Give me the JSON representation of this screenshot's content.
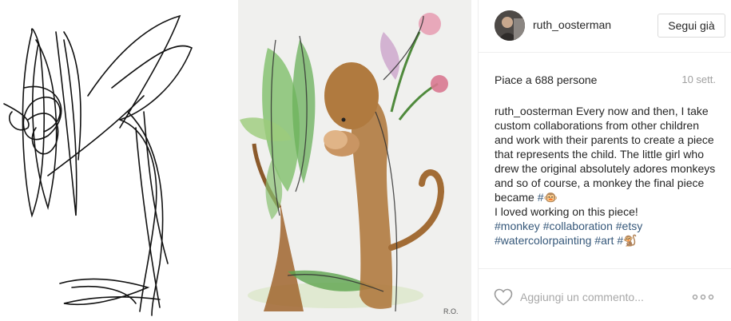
{
  "header": {
    "username": "ruth_oosterman",
    "follow_label": "Segui già"
  },
  "stats": {
    "likes_text": "Piace a 688 persone",
    "time_text": "10 sett."
  },
  "caption": {
    "username": "ruth_oosterman",
    "text": "Every now and then, I take custom collaborations from other children and work with their parents to create a piece that represents the child. The little girl who drew the original absolutely adores monkeys and so of course, a monkey the final piece became",
    "inline_tag": "#🐵",
    "line2": "I loved working on this piece!",
    "tags": [
      "#monkey",
      "#collaboration",
      "#etsy",
      "#watercolorpainting",
      "#art",
      "#🐒"
    ]
  },
  "comment": {
    "placeholder": "Aggiungi un commento..."
  },
  "icons": {
    "like": "heart-outline-icon",
    "more": "more-options-icon"
  },
  "colors": {
    "text": "#262626",
    "muted": "#a0a0a0",
    "hashtag": "#36587a",
    "border": "#dbdbdb"
  }
}
